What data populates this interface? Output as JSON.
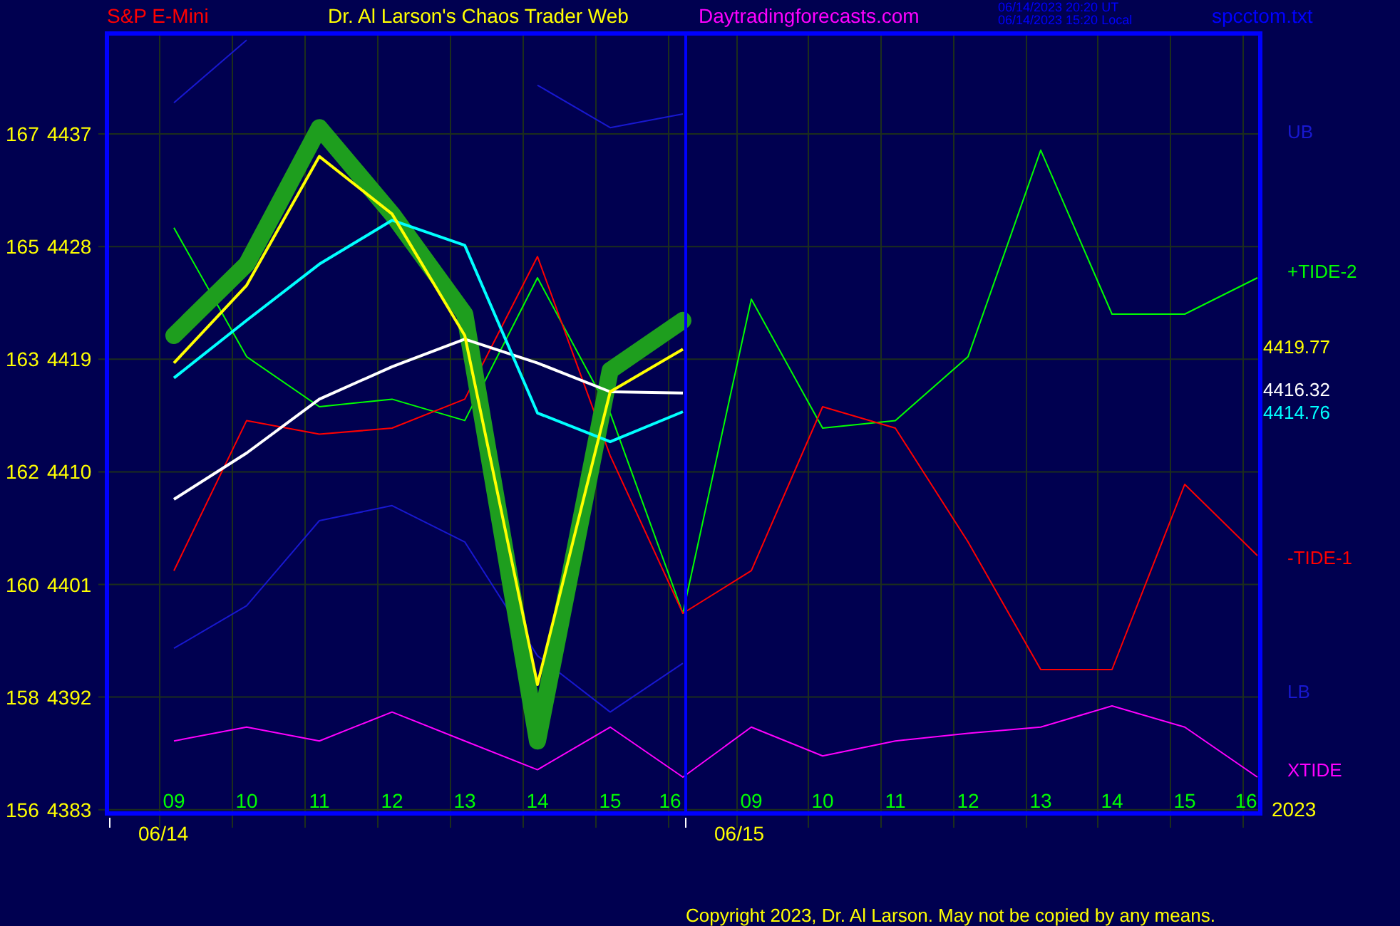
{
  "header": {
    "symbol": "S&P E-Mini",
    "title": "Dr. Al Larson's Chaos Trader Web",
    "site": "Daytradingforecasts.com",
    "timestamps": [
      "06/14/2023 20:20 UT",
      "06/14/2023 15:20 Local"
    ],
    "file": "spcctom.txt"
  },
  "chart": {
    "left_scale": [
      "167",
      "165",
      "163",
      "162",
      "160",
      "158",
      "156"
    ],
    "date_labels": [
      "06/14",
      "06/15"
    ],
    "year_label": "2023",
    "chart_data": {
      "type": "line",
      "grid": true,
      "categories": [
        "09",
        "10",
        "11",
        "12",
        "13",
        "14",
        "15",
        "16",
        "09",
        "10",
        "11",
        "12",
        "13",
        "14",
        "15",
        "16"
      ],
      "ylim": [
        4382.7,
        4445.2
      ],
      "yticks": [
        4437,
        4428,
        4419,
        4410,
        4401,
        4392,
        4383
      ],
      "series": [
        {
          "name": "UB",
          "color": "#1818d0",
          "values": [
            4439.5,
            4444.5,
            null,
            null,
            null,
            4440.9,
            4437.5,
            4438.6,
            null,
            null,
            null,
            null,
            null,
            null,
            null,
            null
          ]
        },
        {
          "name": "+TIDE-2",
          "color": "#00ff00",
          "values": [
            4429.5,
            4419.2,
            4415.2,
            4415.8,
            4414.1,
            4425.5,
            4414.7,
            4398.7,
            4423.8,
            4413.5,
            4414.1,
            4419.2,
            4435.7,
            4422.6,
            4422.6,
            4425.5
          ]
        },
        {
          "name": "-TIDE-1",
          "color": "#ff0000",
          "values": [
            4402.1,
            4414.1,
            4413.0,
            4413.5,
            4415.8,
            4427.2,
            4411.3,
            4398.7,
            4402.1,
            4415.2,
            4413.5,
            4404.4,
            4394.2,
            4394.2,
            4409.0,
            4403.3
          ]
        },
        {
          "name": "LB",
          "color": "#1818d0",
          "values": [
            4395.9,
            4399.3,
            4406.1,
            4407.3,
            4404.4,
            4395.3,
            4390.8,
            4394.7,
            null,
            null,
            null,
            null,
            null,
            null,
            null,
            null
          ]
        },
        {
          "name": "XTIDE",
          "color": "#ff00ff",
          "values": [
            4388.5,
            4389.6,
            4388.5,
            4390.8,
            4388.5,
            4386.2,
            4389.6,
            4385.6,
            4389.6,
            4387.3,
            4388.5,
            4389.1,
            4389.6,
            4391.3,
            4389.6,
            4385.6
          ]
        },
        {
          "color": "#1e9e1e",
          "values": [
            4420.9,
            4426.6,
            4437.5,
            4430.6,
            4422.6,
            4388.5,
            4418.1,
            4422.1,
            null,
            null,
            null,
            null,
            null,
            null,
            null,
            null
          ]
        },
        {
          "color": "#ffffff",
          "values": [
            4407.8,
            4411.5,
            4415.8,
            4418.4,
            4420.6,
            4418.7,
            4416.4,
            4416.3,
            null,
            null,
            null,
            null,
            null,
            null,
            null,
            null
          ]
        },
        {
          "color": "#00ffff",
          "values": [
            4417.5,
            4422.1,
            4426.6,
            4430.1,
            4428.1,
            4414.7,
            4412.4,
            4414.8,
            null,
            null,
            null,
            null,
            null,
            null,
            null,
            null
          ]
        },
        {
          "color": "#ffff00",
          "values": [
            4418.7,
            4424.9,
            4435.2,
            4430.6,
            4420.9,
            4393.0,
            4416.4,
            4419.8,
            null,
            null,
            null,
            null,
            null,
            null,
            null,
            null
          ]
        }
      ],
      "annotations": [
        "4419.77",
        "4416.32",
        "4414.76"
      ]
    }
  },
  "footer": "Copyright 2023, Dr. Al Larson. May not be copied by any means."
}
